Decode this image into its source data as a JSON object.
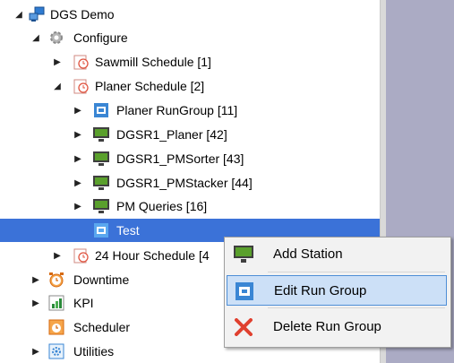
{
  "tree": {
    "nodes": [
      {
        "label": "DGS Demo",
        "icon": "network-icon",
        "toggle": "expanded"
      },
      {
        "label": "Configure",
        "icon": "gear-icon",
        "toggle": "expanded"
      },
      {
        "label": "Sawmill Schedule [1]",
        "icon": "schedule-clock-icon",
        "toggle": "collapsed"
      },
      {
        "label": "Planer Schedule [2]",
        "icon": "schedule-clock-icon",
        "toggle": "expanded"
      },
      {
        "label": "Planer RunGroup [11]",
        "icon": "run-group-icon",
        "toggle": "collapsed"
      },
      {
        "label": "DGSR1_Planer [42]",
        "icon": "station-monitor-icon",
        "toggle": "collapsed"
      },
      {
        "label": "DGSR1_PMSorter [43]",
        "icon": "station-monitor-icon",
        "toggle": "collapsed"
      },
      {
        "label": "DGSR1_PMStacker [44]",
        "icon": "station-monitor-icon",
        "toggle": "collapsed"
      },
      {
        "label": "PM Queries [16]",
        "icon": "station-monitor-icon",
        "toggle": "collapsed"
      },
      {
        "label": "Test",
        "icon": "run-group-icon",
        "toggle": "none",
        "selected": true
      },
      {
        "label": "24 Hour Schedule [4",
        "icon": "schedule-clock-icon",
        "toggle": "collapsed"
      },
      {
        "label": "Downtime",
        "icon": "alarm-clock-icon",
        "toggle": "collapsed"
      },
      {
        "label": "KPI",
        "icon": "kpi-chart-icon",
        "toggle": "collapsed"
      },
      {
        "label": "Scheduler",
        "icon": "scheduler-clock-icon",
        "toggle": "none"
      },
      {
        "label": "Utilities",
        "icon": "utilities-icon",
        "toggle": "collapsed"
      }
    ]
  },
  "context_menu": {
    "items": [
      {
        "label": "Add Station",
        "icon": "station-monitor-icon"
      },
      {
        "label": "Edit Run Group",
        "icon": "run-group-icon",
        "highlighted": true
      },
      {
        "label": "Delete Run Group",
        "icon": "delete-x-icon"
      }
    ]
  },
  "colors": {
    "selection": "#3b72d8",
    "menu_highlight": "#cce0f7",
    "menu_highlight_border": "#4e8ed6",
    "right_pane": "#ababc4"
  }
}
